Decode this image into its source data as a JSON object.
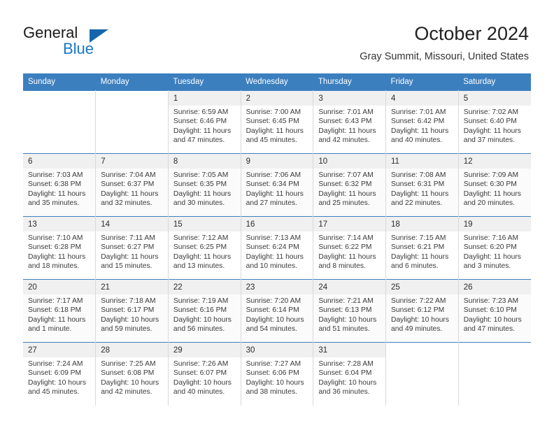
{
  "brand": {
    "word_one": "General",
    "word_two": "Blue",
    "triangle_icon": "triangle-icon",
    "accent_color": "#1878c8"
  },
  "header": {
    "title": "October 2024",
    "subtitle": "Gray Summit, Missouri, United States"
  },
  "theme": {
    "header_row_bg": "#3c7fbf",
    "header_row_text": "#ffffff",
    "daynum_bg": "#f0f0f0",
    "row_shade": "#fbfbfb"
  },
  "weekdays": [
    "Sunday",
    "Monday",
    "Tuesday",
    "Wednesday",
    "Thursday",
    "Friday",
    "Saturday"
  ],
  "labels": {
    "sunrise_prefix": "Sunrise:",
    "sunset_prefix": "Sunset:",
    "daylight_prefix": "Daylight:"
  },
  "weeks": [
    [
      {
        "day": "",
        "sunrise": "",
        "sunset": "",
        "daylight_a": "",
        "daylight_b": ""
      },
      {
        "day": "",
        "sunrise": "",
        "sunset": "",
        "daylight_a": "",
        "daylight_b": ""
      },
      {
        "day": "1",
        "sunrise": "Sunrise: 6:59 AM",
        "sunset": "Sunset: 6:46 PM",
        "daylight_a": "Daylight: 11 hours",
        "daylight_b": "and 47 minutes."
      },
      {
        "day": "2",
        "sunrise": "Sunrise: 7:00 AM",
        "sunset": "Sunset: 6:45 PM",
        "daylight_a": "Daylight: 11 hours",
        "daylight_b": "and 45 minutes."
      },
      {
        "day": "3",
        "sunrise": "Sunrise: 7:01 AM",
        "sunset": "Sunset: 6:43 PM",
        "daylight_a": "Daylight: 11 hours",
        "daylight_b": "and 42 minutes."
      },
      {
        "day": "4",
        "sunrise": "Sunrise: 7:01 AM",
        "sunset": "Sunset: 6:42 PM",
        "daylight_a": "Daylight: 11 hours",
        "daylight_b": "and 40 minutes."
      },
      {
        "day": "5",
        "sunrise": "Sunrise: 7:02 AM",
        "sunset": "Sunset: 6:40 PM",
        "daylight_a": "Daylight: 11 hours",
        "daylight_b": "and 37 minutes."
      }
    ],
    [
      {
        "day": "6",
        "sunrise": "Sunrise: 7:03 AM",
        "sunset": "Sunset: 6:38 PM",
        "daylight_a": "Daylight: 11 hours",
        "daylight_b": "and 35 minutes."
      },
      {
        "day": "7",
        "sunrise": "Sunrise: 7:04 AM",
        "sunset": "Sunset: 6:37 PM",
        "daylight_a": "Daylight: 11 hours",
        "daylight_b": "and 32 minutes."
      },
      {
        "day": "8",
        "sunrise": "Sunrise: 7:05 AM",
        "sunset": "Sunset: 6:35 PM",
        "daylight_a": "Daylight: 11 hours",
        "daylight_b": "and 30 minutes."
      },
      {
        "day": "9",
        "sunrise": "Sunrise: 7:06 AM",
        "sunset": "Sunset: 6:34 PM",
        "daylight_a": "Daylight: 11 hours",
        "daylight_b": "and 27 minutes."
      },
      {
        "day": "10",
        "sunrise": "Sunrise: 7:07 AM",
        "sunset": "Sunset: 6:32 PM",
        "daylight_a": "Daylight: 11 hours",
        "daylight_b": "and 25 minutes."
      },
      {
        "day": "11",
        "sunrise": "Sunrise: 7:08 AM",
        "sunset": "Sunset: 6:31 PM",
        "daylight_a": "Daylight: 11 hours",
        "daylight_b": "and 22 minutes."
      },
      {
        "day": "12",
        "sunrise": "Sunrise: 7:09 AM",
        "sunset": "Sunset: 6:30 PM",
        "daylight_a": "Daylight: 11 hours",
        "daylight_b": "and 20 minutes."
      }
    ],
    [
      {
        "day": "13",
        "sunrise": "Sunrise: 7:10 AM",
        "sunset": "Sunset: 6:28 PM",
        "daylight_a": "Daylight: 11 hours",
        "daylight_b": "and 18 minutes."
      },
      {
        "day": "14",
        "sunrise": "Sunrise: 7:11 AM",
        "sunset": "Sunset: 6:27 PM",
        "daylight_a": "Daylight: 11 hours",
        "daylight_b": "and 15 minutes."
      },
      {
        "day": "15",
        "sunrise": "Sunrise: 7:12 AM",
        "sunset": "Sunset: 6:25 PM",
        "daylight_a": "Daylight: 11 hours",
        "daylight_b": "and 13 minutes."
      },
      {
        "day": "16",
        "sunrise": "Sunrise: 7:13 AM",
        "sunset": "Sunset: 6:24 PM",
        "daylight_a": "Daylight: 11 hours",
        "daylight_b": "and 10 minutes."
      },
      {
        "day": "17",
        "sunrise": "Sunrise: 7:14 AM",
        "sunset": "Sunset: 6:22 PM",
        "daylight_a": "Daylight: 11 hours",
        "daylight_b": "and 8 minutes."
      },
      {
        "day": "18",
        "sunrise": "Sunrise: 7:15 AM",
        "sunset": "Sunset: 6:21 PM",
        "daylight_a": "Daylight: 11 hours",
        "daylight_b": "and 6 minutes."
      },
      {
        "day": "19",
        "sunrise": "Sunrise: 7:16 AM",
        "sunset": "Sunset: 6:20 PM",
        "daylight_a": "Daylight: 11 hours",
        "daylight_b": "and 3 minutes."
      }
    ],
    [
      {
        "day": "20",
        "sunrise": "Sunrise: 7:17 AM",
        "sunset": "Sunset: 6:18 PM",
        "daylight_a": "Daylight: 11 hours",
        "daylight_b": "and 1 minute."
      },
      {
        "day": "21",
        "sunrise": "Sunrise: 7:18 AM",
        "sunset": "Sunset: 6:17 PM",
        "daylight_a": "Daylight: 10 hours",
        "daylight_b": "and 59 minutes."
      },
      {
        "day": "22",
        "sunrise": "Sunrise: 7:19 AM",
        "sunset": "Sunset: 6:16 PM",
        "daylight_a": "Daylight: 10 hours",
        "daylight_b": "and 56 minutes."
      },
      {
        "day": "23",
        "sunrise": "Sunrise: 7:20 AM",
        "sunset": "Sunset: 6:14 PM",
        "daylight_a": "Daylight: 10 hours",
        "daylight_b": "and 54 minutes."
      },
      {
        "day": "24",
        "sunrise": "Sunrise: 7:21 AM",
        "sunset": "Sunset: 6:13 PM",
        "daylight_a": "Daylight: 10 hours",
        "daylight_b": "and 51 minutes."
      },
      {
        "day": "25",
        "sunrise": "Sunrise: 7:22 AM",
        "sunset": "Sunset: 6:12 PM",
        "daylight_a": "Daylight: 10 hours",
        "daylight_b": "and 49 minutes."
      },
      {
        "day": "26",
        "sunrise": "Sunrise: 7:23 AM",
        "sunset": "Sunset: 6:10 PM",
        "daylight_a": "Daylight: 10 hours",
        "daylight_b": "and 47 minutes."
      }
    ],
    [
      {
        "day": "27",
        "sunrise": "Sunrise: 7:24 AM",
        "sunset": "Sunset: 6:09 PM",
        "daylight_a": "Daylight: 10 hours",
        "daylight_b": "and 45 minutes."
      },
      {
        "day": "28",
        "sunrise": "Sunrise: 7:25 AM",
        "sunset": "Sunset: 6:08 PM",
        "daylight_a": "Daylight: 10 hours",
        "daylight_b": "and 42 minutes."
      },
      {
        "day": "29",
        "sunrise": "Sunrise: 7:26 AM",
        "sunset": "Sunset: 6:07 PM",
        "daylight_a": "Daylight: 10 hours",
        "daylight_b": "and 40 minutes."
      },
      {
        "day": "30",
        "sunrise": "Sunrise: 7:27 AM",
        "sunset": "Sunset: 6:06 PM",
        "daylight_a": "Daylight: 10 hours",
        "daylight_b": "and 38 minutes."
      },
      {
        "day": "31",
        "sunrise": "Sunrise: 7:28 AM",
        "sunset": "Sunset: 6:04 PM",
        "daylight_a": "Daylight: 10 hours",
        "daylight_b": "and 36 minutes."
      },
      {
        "day": "",
        "sunrise": "",
        "sunset": "",
        "daylight_a": "",
        "daylight_b": ""
      },
      {
        "day": "",
        "sunrise": "",
        "sunset": "",
        "daylight_a": "",
        "daylight_b": ""
      }
    ]
  ]
}
